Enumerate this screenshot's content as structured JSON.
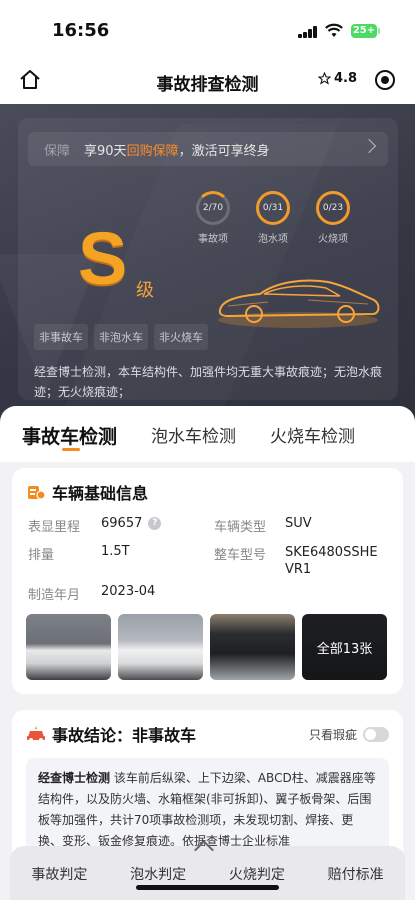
{
  "status": {
    "time": "16:56",
    "battery": "25+"
  },
  "nav": {
    "title": "事故排查检测",
    "rating": "4.8"
  },
  "hero": {
    "guarantee_tag": "保障",
    "guarantee_pre": "享90天",
    "guarantee_hl": "回购保障",
    "guarantee_post": "，激活可享终身",
    "grade": "S",
    "grade_suffix": "级",
    "metrics": [
      {
        "value": "2/70",
        "label": "事故项"
      },
      {
        "value": "0/31",
        "label": "泡水项"
      },
      {
        "value": "0/23",
        "label": "火烧项"
      }
    ],
    "pills": [
      "非事故车",
      "非泡水车",
      "非火烧车"
    ],
    "description": "经查博士检测，本车结构件、加强件均无重大事故痕迹；无泡水痕迹；无火烧痕迹；"
  },
  "tabs": [
    "事故车检测",
    "泡水车检测",
    "火烧车检测"
  ],
  "vehicle": {
    "title": "车辆基础信息",
    "mileage_label": "表显里程",
    "mileage_value": "69657",
    "type_label": "车辆类型",
    "type_value": "SUV",
    "displacement_label": "排量",
    "displacement_value": "1.5T",
    "model_label": "整车型号",
    "model_value_1": "SKE6480SSHE",
    "model_value_2": "VR1",
    "date_label": "制造年月",
    "date_value": "2023-04",
    "photos_more": "全部13张"
  },
  "conclusion": {
    "title": "事故结论：非事故车",
    "toggle_label": "只看瑕疵",
    "lead": "经查博士检测",
    "body": "该车前后纵梁、上下边梁、ABCD柱、减震器座等结构件，以及防火墙、水箱框架(非可拆卸)、翼子板骨架、后围板等加强件，共计70项事故检测项，未发现切割、焊接、更换、变形、钣金修复痕迹。依据查博士企业标准"
  },
  "bottom_tabs": [
    "事故判定",
    "泡水判定",
    "火烧判定",
    "赔付标准"
  ],
  "colors": {
    "accent": "#f58a1f",
    "hero_bg": "#3a3c49"
  }
}
